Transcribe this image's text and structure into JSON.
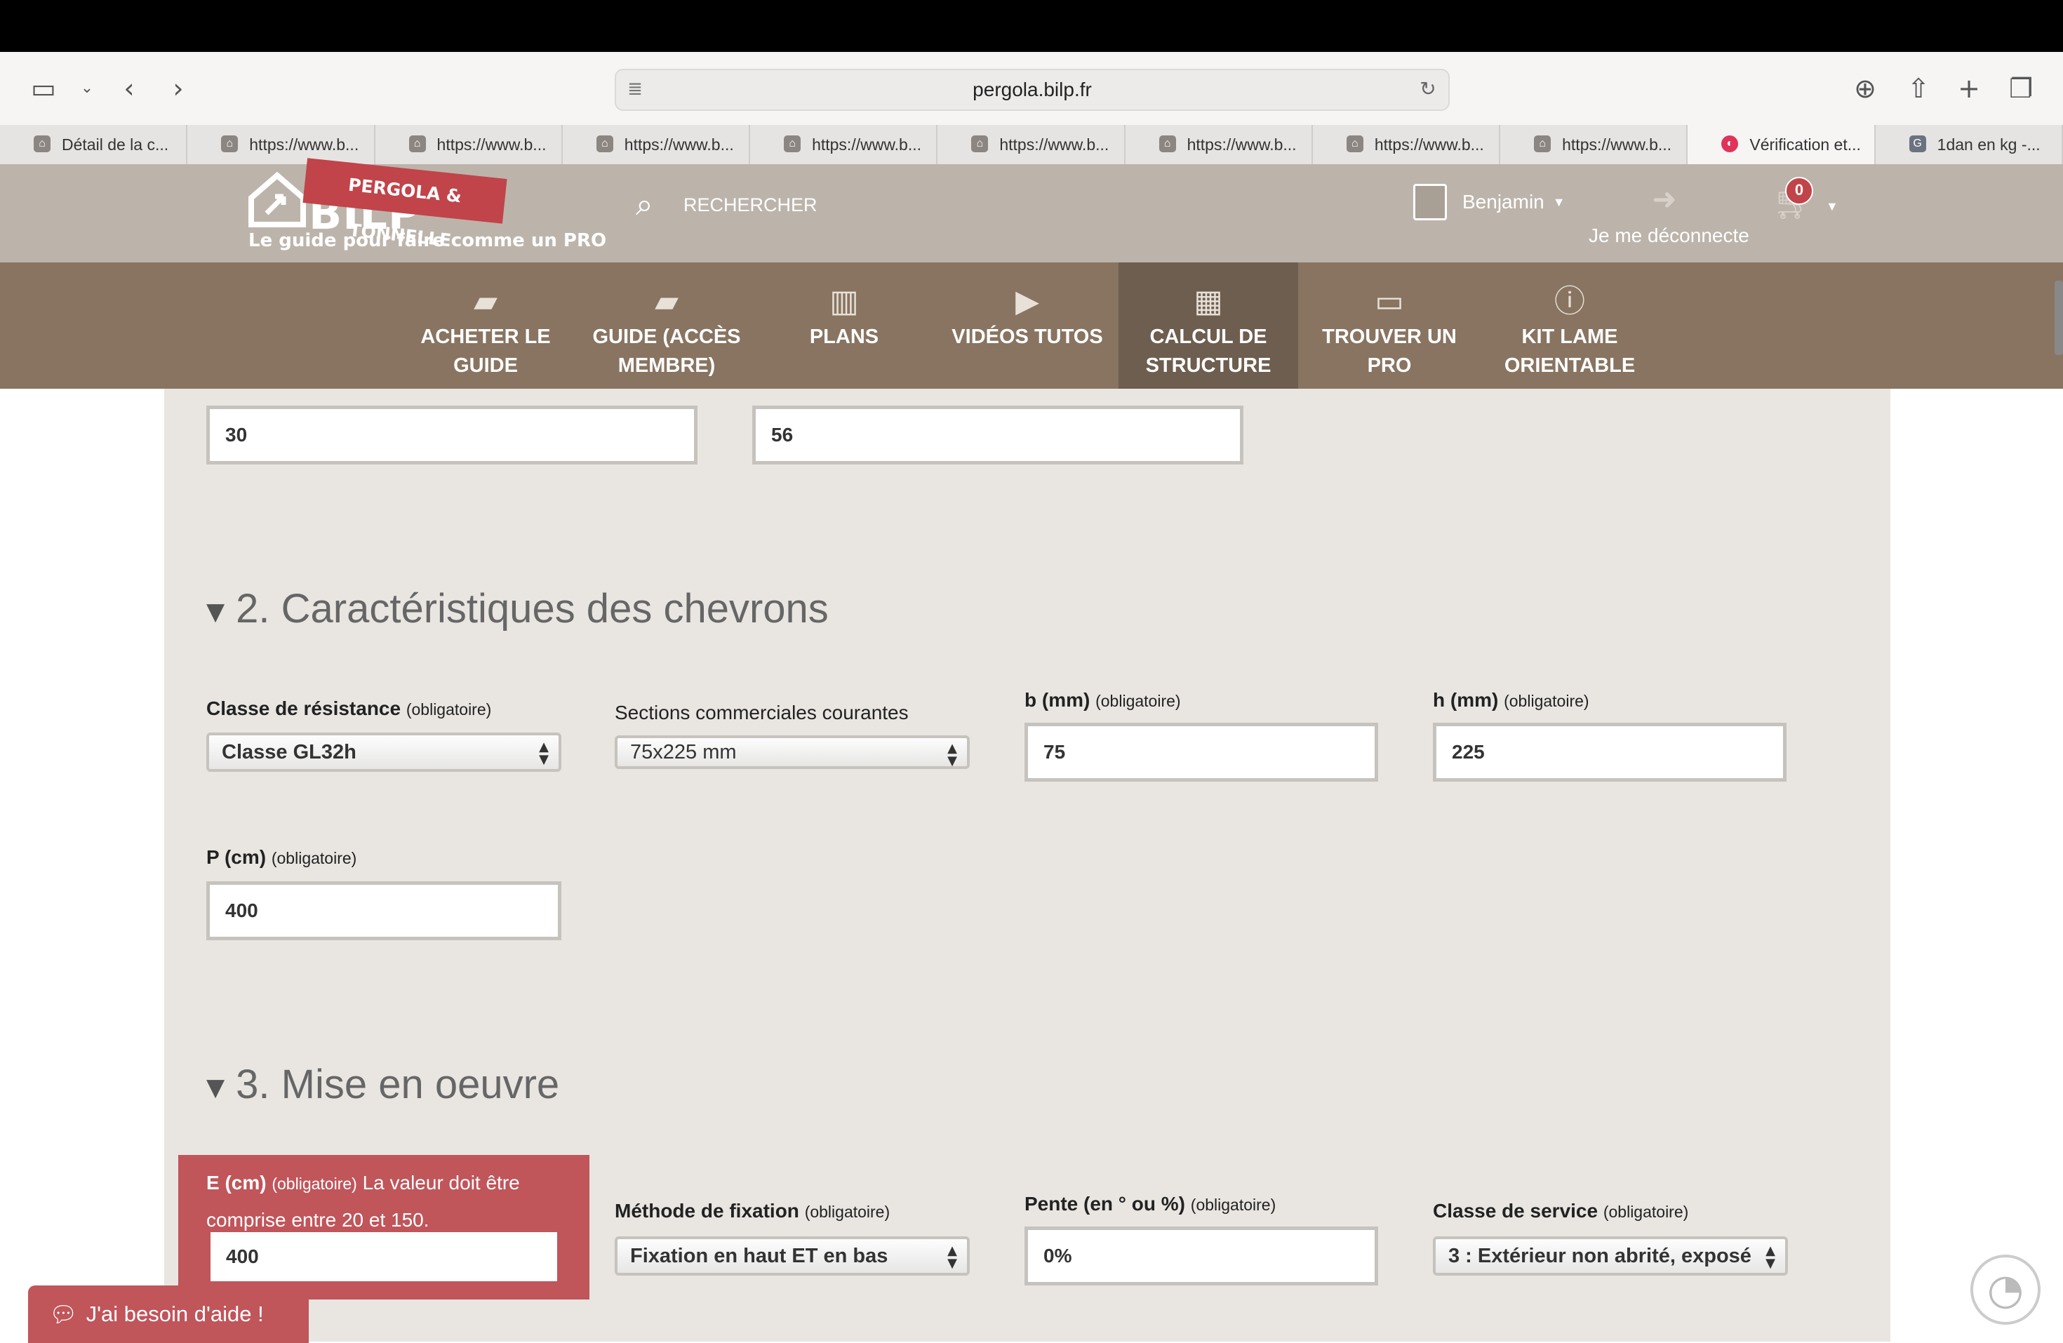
{
  "browser": {
    "url": "pergola.bilp.fr",
    "tabs": [
      {
        "label": "Détail de la c..."
      },
      {
        "label": "https://www.b..."
      },
      {
        "label": "https://www.b..."
      },
      {
        "label": "https://www.b..."
      },
      {
        "label": "https://www.b..."
      },
      {
        "label": "https://www.b..."
      },
      {
        "label": "https://www.b..."
      },
      {
        "label": "https://www.b..."
      },
      {
        "label": "https://www.b..."
      },
      {
        "label": "Vérification et..."
      },
      {
        "label": "1dan en kg -..."
      }
    ]
  },
  "header": {
    "logo_ribbon": "PERGOLA & TONNELLE",
    "logo_word": "BILP",
    "tagline": "Le guide pour faire comme un PRO",
    "search_label": "RECHERCHER",
    "user_name": "Benjamin",
    "logout_label": "Je me déconnecte",
    "cart_count": "0"
  },
  "nav": {
    "items": [
      {
        "line1": "ACHETER LE",
        "line2": "GUIDE"
      },
      {
        "line1": "GUIDE (ACCÈS",
        "line2": "MEMBRE)"
      },
      {
        "line1": "PLANS",
        "line2": ""
      },
      {
        "line1": "VIDÉOS TUTOS",
        "line2": ""
      },
      {
        "line1": "CALCUL DE",
        "line2": "STRUCTURE"
      },
      {
        "line1": "TROUVER UN",
        "line2": "PRO"
      },
      {
        "line1": "KIT LAME",
        "line2": "ORIENTABLE"
      }
    ]
  },
  "section1": {
    "field_a_value": "30",
    "field_b_value": "56"
  },
  "section2": {
    "title": "2. Caractéristiques des chevrons",
    "required": "(obligatoire)",
    "classe_label": "Classe de résistance",
    "classe_value": "Classe GL32h",
    "sections_label": "Sections commerciales courantes",
    "sections_value": "75x225 mm",
    "b_label": "b (mm)",
    "b_value": "75",
    "h_label": "h (mm)",
    "h_value": "225",
    "p_label": "P (cm)",
    "p_value": "400"
  },
  "section3": {
    "title": "3. Mise en oeuvre",
    "required": "(obligatoire)",
    "e_label": "E (cm)",
    "e_error_1": "La valeur doit être",
    "e_error_2": "comprise entre 20 et 150.",
    "e_value": "400",
    "methode_label": "Méthode de fixation",
    "methode_value": "Fixation en haut ET en bas",
    "pente_label": "Pente (en ° ou %)",
    "pente_value": "0%",
    "classe_service_label": "Classe de service",
    "classe_service_value": "3 : Extérieur non abrité, exposé"
  },
  "help": {
    "label": "J'ai besoin d'aide !"
  },
  "colors": {
    "brand_red": "#c0444a",
    "nav_bg": "#887461",
    "header_bg": "#bcb4ab",
    "panel_bg": "#e9e6e2"
  }
}
